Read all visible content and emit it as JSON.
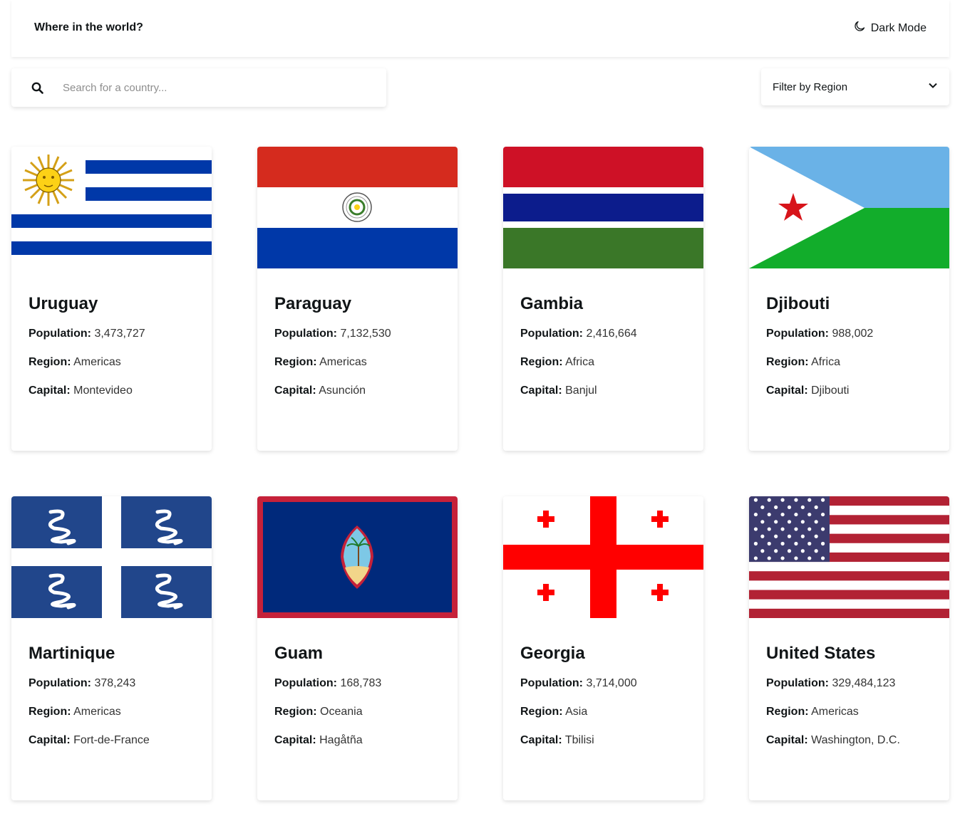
{
  "header": {
    "title": "Where in the world?",
    "mode_label": "Dark Mode"
  },
  "search": {
    "placeholder": "Search for a country..."
  },
  "filter": {
    "label": "Filter by Region"
  },
  "labels": {
    "population": "Population:",
    "region": "Region:",
    "capital": "Capital:"
  },
  "countries": [
    {
      "name": "Uruguay",
      "population": "3,473,727",
      "region": "Americas",
      "capital": "Montevideo"
    },
    {
      "name": "Paraguay",
      "population": "7,132,530",
      "region": "Americas",
      "capital": "Asunción"
    },
    {
      "name": "Gambia",
      "population": "2,416,664",
      "region": "Africa",
      "capital": "Banjul"
    },
    {
      "name": "Djibouti",
      "population": "988,002",
      "region": "Africa",
      "capital": "Djibouti"
    },
    {
      "name": "Martinique",
      "population": "378,243",
      "region": "Americas",
      "capital": "Fort-de-France"
    },
    {
      "name": "Guam",
      "population": "168,783",
      "region": "Oceania",
      "capital": "Hagåtña"
    },
    {
      "name": "Georgia",
      "population": "3,714,000",
      "region": "Asia",
      "capital": "Tbilisi"
    },
    {
      "name": "United States",
      "population": "329,484,123",
      "region": "Americas",
      "capital": "Washington, D.C."
    }
  ],
  "colors": {
    "text": "#111517",
    "card_bg": "#ffffff",
    "page_bg": "#ffffff"
  }
}
